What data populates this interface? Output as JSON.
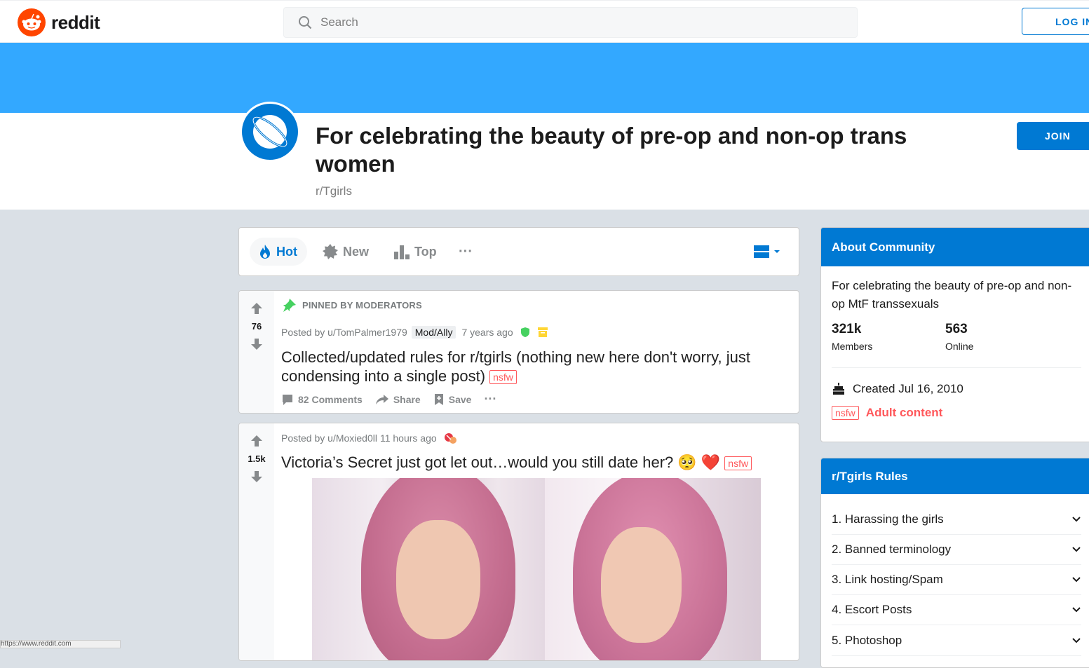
{
  "header": {
    "logo_text": "reddit",
    "search_placeholder": "Search",
    "login_label": "LOG IN"
  },
  "community": {
    "title": "For celebrating the beauty of pre-op and non-op trans women",
    "name": "r/Tgirls",
    "join_label": "JOIN",
    "banner_color": "#33a8ff"
  },
  "sort": {
    "items": [
      {
        "label": "Hot",
        "icon": "flame-icon",
        "active": true
      },
      {
        "label": "New",
        "icon": "sparkle-icon"
      },
      {
        "label": "Top",
        "icon": "bar-chart-icon"
      }
    ],
    "more": "···"
  },
  "posts": [
    {
      "pinned_label": "PINNED BY MODERATORS",
      "votes": "76",
      "posted_by": "Posted by u/TomPalmer1979",
      "flair": "Mod/Ally",
      "time": "7 years ago",
      "title": "Collected/updated rules for r/tgirls (nothing new here don't worry, just condensing into a single post)",
      "nsfw": "nsfw",
      "comments": "82 Comments",
      "share": "Share",
      "save": "Save",
      "more": "···"
    },
    {
      "votes": "1.5k",
      "posted_by": "Posted by u/Moxied0ll",
      "time": "11 hours ago",
      "title": "Victoria’s Secret just got let out…would you still date her?",
      "emoji": "🥺 ❤️",
      "nsfw": "nsfw"
    }
  ],
  "about": {
    "heading": "About Community",
    "description": "For celebrating the beauty of pre-op and non-op MtF transsexuals",
    "members_count": "321k",
    "members_label": "Members",
    "online_count": "563",
    "online_label": "Online",
    "created": "Created Jul 16, 2010",
    "nsfw": "nsfw",
    "adult_label": "Adult content"
  },
  "rules": {
    "heading": "r/Tgirls Rules",
    "items": [
      "1. Harassing the girls",
      "2. Banned terminology",
      "3. Link hosting/Spam",
      "4. Escort Posts",
      "5. Photoshop"
    ]
  },
  "statusbar": "https://www.reddit.com"
}
